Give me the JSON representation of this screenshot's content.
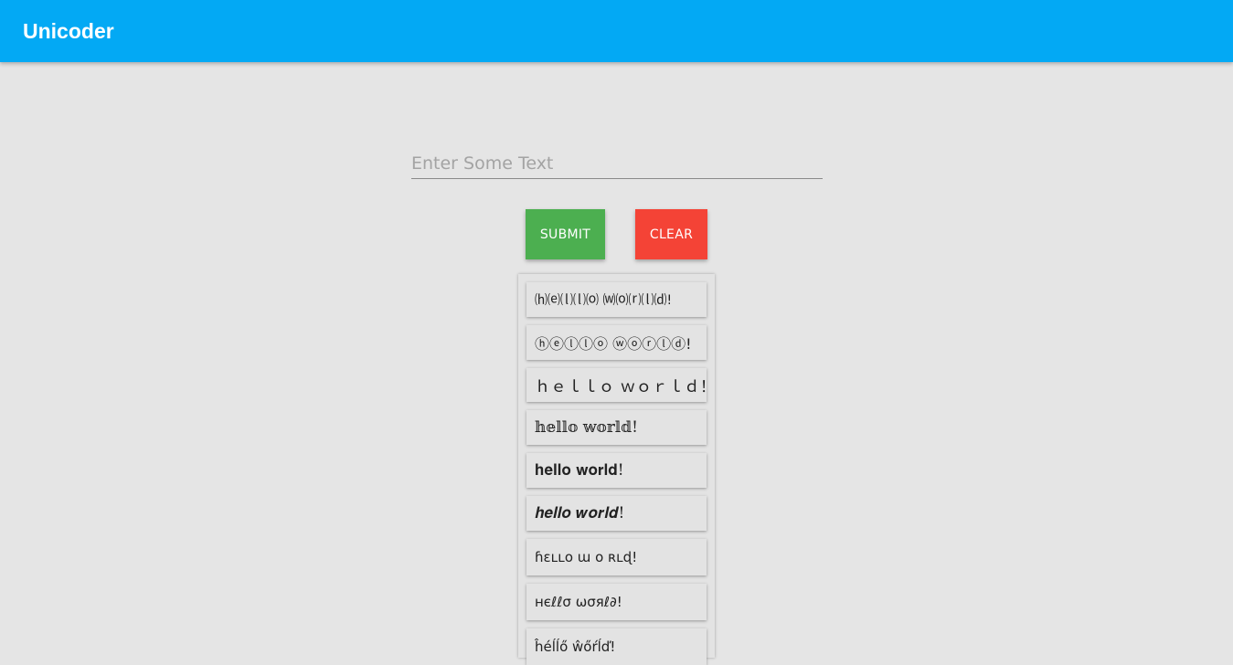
{
  "appbar": {
    "title": "Unicoder",
    "color": "#03a9f4"
  },
  "input": {
    "placeholder": "Enter Some Text",
    "value": ""
  },
  "buttons": {
    "submit_label": "SUBMIT",
    "submit_color": "#4caf50",
    "clear_label": "CLEAR",
    "clear_color": "#f44336"
  },
  "results": [
    "⒣⒠⒧⒧⒪ ⒲⒪⒭⒧⒟!",
    "ⓗⓔⓛⓛⓞ ⓦⓞⓡⓛⓓ!",
    "ｈｅｌｌｏ ｗｏｒｌｄ！",
    "𝕙𝕖𝕝𝕝𝕠 𝕨𝕠𝕣𝕝𝕕!",
    "𝐡𝐞𝐥𝐥𝐨 𝐰𝐨𝐫𝐥𝐝!",
    "𝒉𝒆𝒍𝒍𝒐 𝒘𝒐𝒓𝒍𝒅!",
    "ɦɛʟʟօ ա օ ʀʟɖ!",
    "нєℓℓσ ωσяℓ∂!",
    "ĥéĺĺő ŵőŕĺď!"
  ]
}
